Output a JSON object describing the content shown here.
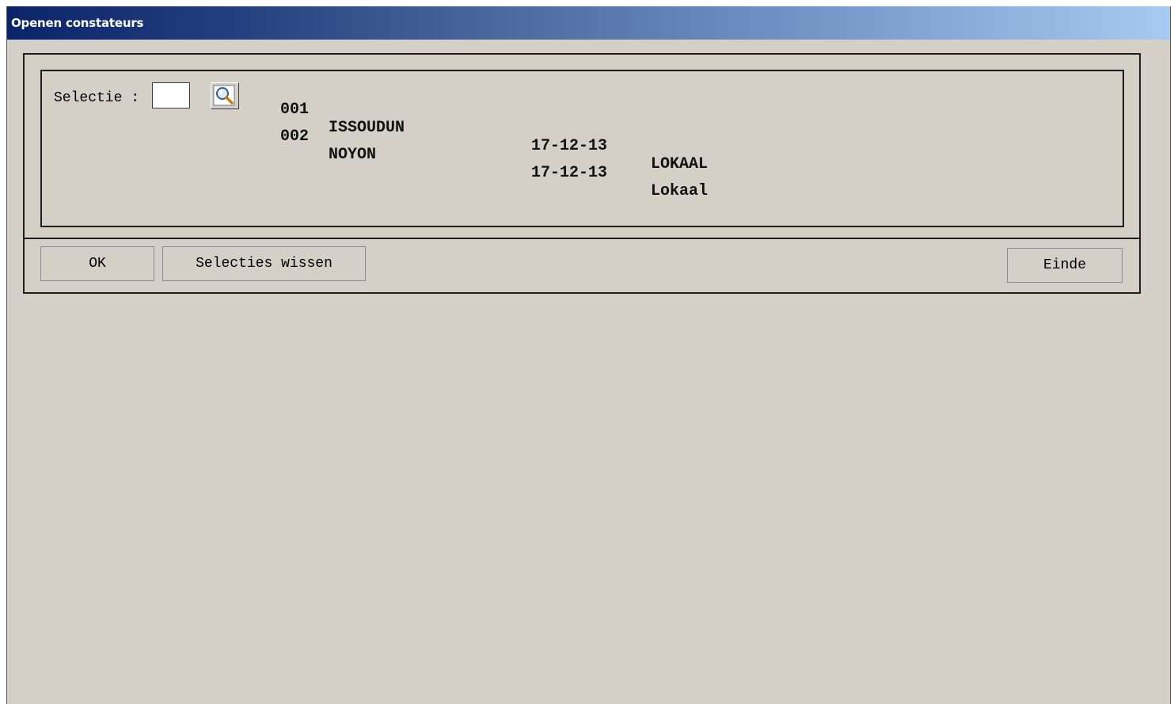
{
  "window": {
    "title": "Openen constateurs"
  },
  "selection": {
    "label": "Selectie :",
    "value": "",
    "search_icon": "magnifier-icon"
  },
  "rows": [
    {
      "code": "001",
      "name": "ISSOUDUN",
      "date": "17-12-13",
      "type": "LOKAAL"
    },
    {
      "code": "002",
      "name": "NOYON",
      "date": "17-12-13",
      "type": "Lokaal"
    }
  ],
  "buttons": {
    "ok": "OK",
    "clear": "Selecties wissen",
    "exit": "Einde"
  },
  "colors": {
    "title_gradient_start": "#0a246a",
    "title_gradient_end": "#a6caf0",
    "background": "#d4d0c8"
  }
}
